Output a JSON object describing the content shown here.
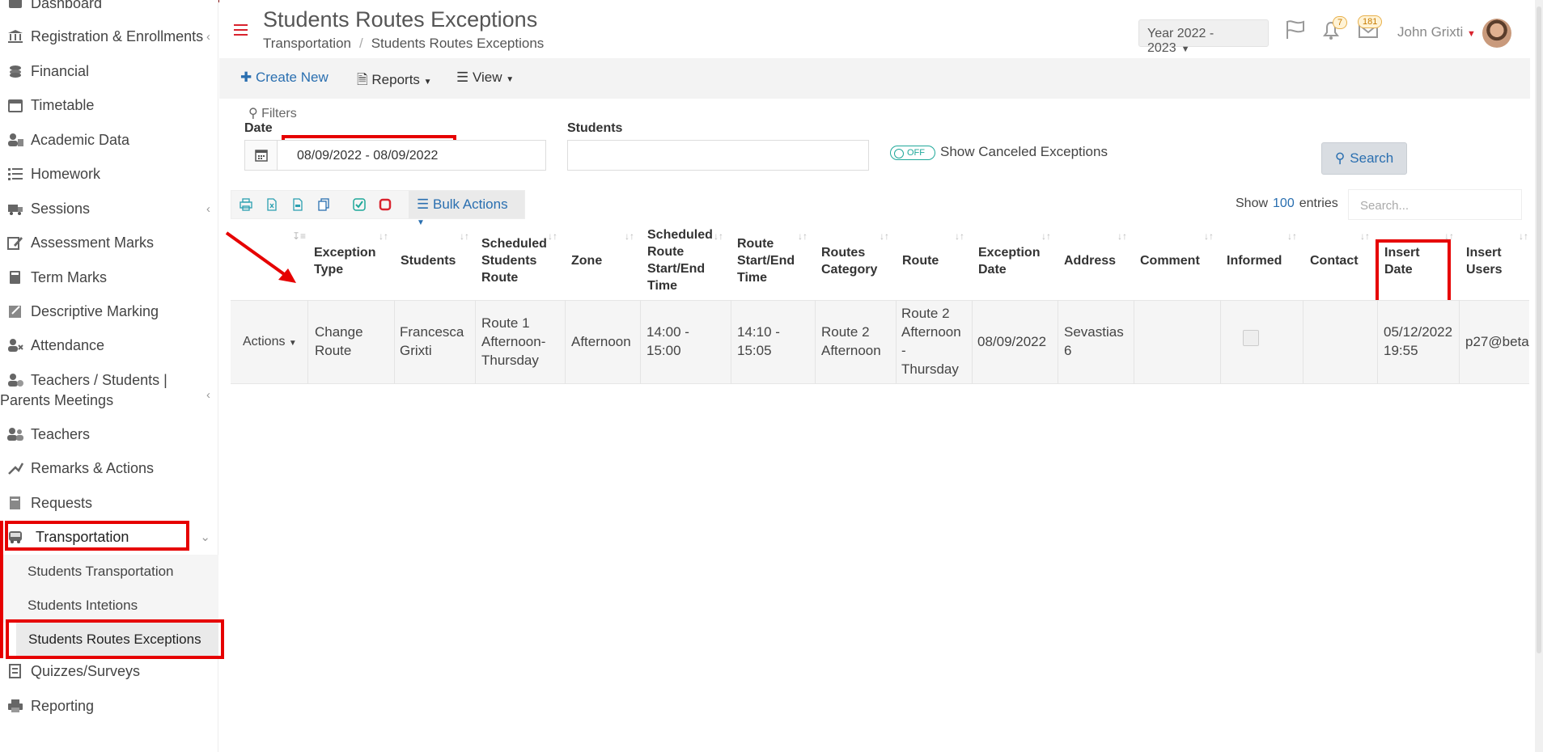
{
  "sidebar": {
    "items": [
      {
        "label": "Dashboard",
        "icon": "dashboard-icon"
      },
      {
        "label": "Registration & Enrollments",
        "icon": "bank-icon",
        "chevron": "‹"
      },
      {
        "label": "Financial",
        "icon": "coins-icon"
      },
      {
        "label": "Timetable",
        "icon": "calendar-icon"
      },
      {
        "label": "Academic Data",
        "icon": "users-icon"
      },
      {
        "label": "Homework",
        "icon": "list-icon"
      },
      {
        "label": "Sessions",
        "icon": "truck-icon",
        "chevron": "‹"
      },
      {
        "label": "Assessment Marks",
        "icon": "edit-icon"
      },
      {
        "label": "Term Marks",
        "icon": "book-icon"
      },
      {
        "label": "Descriptive Marking",
        "icon": "note-icon"
      },
      {
        "label": "Attendance",
        "icon": "user-check-icon"
      },
      {
        "label": "Teachers / Students |",
        "label2": "Parents Meetings",
        "icon": "meeting-icon",
        "chevron": "‹"
      },
      {
        "label": "Teachers",
        "icon": "teachers-icon"
      },
      {
        "label": "Remarks & Actions",
        "icon": "remarks-icon"
      },
      {
        "label": "Requests",
        "icon": "request-icon"
      },
      {
        "label": "Transportation",
        "icon": "bus-icon",
        "chevron": "⌄"
      },
      {
        "label": "Quizzes/Surveys",
        "icon": "quiz-icon"
      },
      {
        "label": "Reporting",
        "icon": "printer-icon"
      }
    ],
    "subitems": [
      {
        "label": "Students Transportation"
      },
      {
        "label": "Students Intetions"
      },
      {
        "label": "Students Routes Exceptions"
      }
    ]
  },
  "header": {
    "title": "Students Routes Exceptions",
    "breadcrumb": [
      "Transportation",
      "Students Routes Exceptions"
    ],
    "year": "Year 2022 - 2023",
    "notif_count": "7",
    "mail_count": "181",
    "user": "John Grixti"
  },
  "toolbar": {
    "create_new": "Create New",
    "reports": "Reports",
    "view": "View"
  },
  "filters": {
    "title": "Filters",
    "date_label": "Date",
    "date_value": "08/09/2022 - 08/09/2022",
    "students_label": "Students",
    "toggle_state": "OFF",
    "toggle_label": "Show Canceled Exceptions",
    "search": "Search"
  },
  "table_tools": {
    "bulk_actions": "Bulk Actions",
    "show": "Show",
    "entries_count": "100",
    "entries": "entries",
    "search_placeholder": "Search..."
  },
  "table": {
    "columns": [
      [
        "Exception",
        "Type"
      ],
      [
        "Students"
      ],
      [
        "Scheduled",
        "Students",
        "Route"
      ],
      [
        "Zone"
      ],
      [
        "Scheduled",
        "Route",
        "Start/End",
        "Time"
      ],
      [
        "Route",
        "Start/End",
        "Time"
      ],
      [
        "Routes",
        "Category"
      ],
      [
        "Route"
      ],
      [
        "Exception",
        "Date"
      ],
      [
        "Address"
      ],
      [
        "Comment"
      ],
      [
        "Informed"
      ],
      [
        "Contact"
      ],
      [
        "Insert",
        "Date"
      ],
      [
        "Insert",
        "Users"
      ]
    ],
    "row": {
      "actions": "Actions",
      "cells": [
        [
          "Change",
          "Route"
        ],
        [
          "Francesca",
          "Grixti"
        ],
        [
          "Route 1",
          "Afternoon-",
          "Thursday"
        ],
        [
          "Afternoon"
        ],
        [
          "14:00 -",
          "15:00"
        ],
        [
          "14:10 -",
          "15:05"
        ],
        [
          "Route 2",
          "Afternoon"
        ],
        [
          "Route 2",
          "Afternoon",
          "-",
          "Thursday"
        ],
        [
          "08/09/2022"
        ],
        [
          "Sevastias",
          "6"
        ],
        [
          ""
        ],
        [
          ""
        ],
        [
          ""
        ],
        [
          "05/12/2022",
          "19:55"
        ],
        [
          "p27@beta"
        ]
      ]
    }
  },
  "colors": {
    "accent": "#2a6fb0",
    "highlight": "#e60000",
    "topbar": "#8b1a1a"
  }
}
